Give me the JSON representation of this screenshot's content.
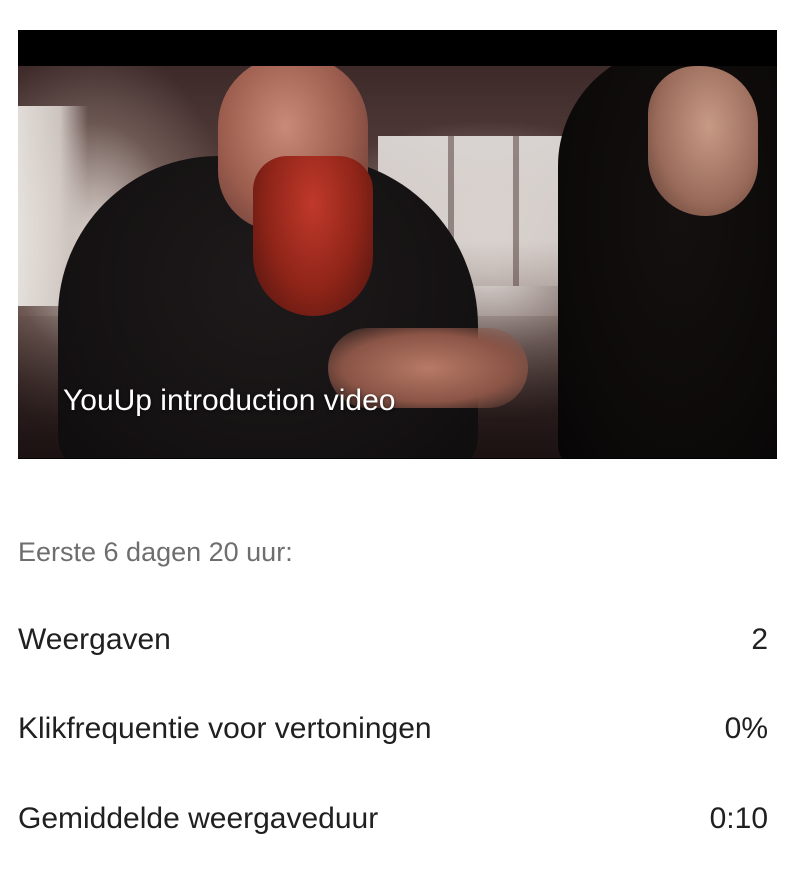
{
  "video": {
    "title": "YouUp introduction video"
  },
  "stats": {
    "period_label": "Eerste 6 dagen 20 uur:",
    "rows": [
      {
        "label": "Weergaven",
        "value": "2"
      },
      {
        "label": "Klikfrequentie voor vertoningen",
        "value": "0%"
      },
      {
        "label": "Gemiddelde weergaveduur",
        "value": "0:10"
      }
    ]
  }
}
